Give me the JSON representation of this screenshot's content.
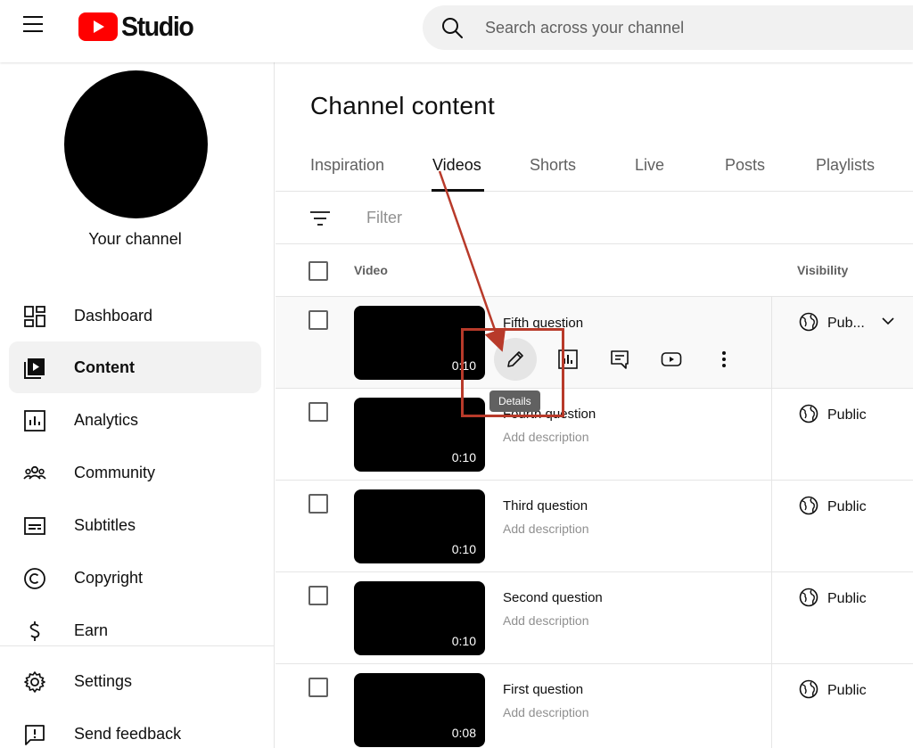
{
  "header": {
    "logo_text": "Studio",
    "search_placeholder": "Search across your channel"
  },
  "sidebar": {
    "channel_label": "Your channel",
    "items": [
      {
        "label": "Dashboard",
        "icon": "dashboard-icon"
      },
      {
        "label": "Content",
        "icon": "content-icon",
        "active": true
      },
      {
        "label": "Analytics",
        "icon": "analytics-icon"
      },
      {
        "label": "Community",
        "icon": "community-icon"
      },
      {
        "label": "Subtitles",
        "icon": "subtitles-icon"
      },
      {
        "label": "Copyright",
        "icon": "copyright-icon"
      },
      {
        "label": "Earn",
        "icon": "earn-icon"
      },
      {
        "label": "Settings",
        "icon": "gear-icon"
      },
      {
        "label": "Send feedback",
        "icon": "feedback-icon"
      }
    ]
  },
  "main": {
    "title": "Channel content",
    "tabs": [
      "Inspiration",
      "Videos",
      "Shorts",
      "Live",
      "Posts",
      "Playlists"
    ],
    "active_tab": "Videos",
    "filter_placeholder": "Filter",
    "columns": {
      "video": "Video",
      "visibility": "Visibility"
    },
    "rows": [
      {
        "title": "Fifth question",
        "description": "",
        "duration": "0:10",
        "visibility": "Pub..."
      },
      {
        "title": "Fourth question",
        "description": "Add description",
        "duration": "0:10",
        "visibility": "Public"
      },
      {
        "title": "Third question",
        "description": "Add description",
        "duration": "0:10",
        "visibility": "Public"
      },
      {
        "title": "Second question",
        "description": "Add description",
        "duration": "0:10",
        "visibility": "Public"
      },
      {
        "title": "First question",
        "description": "Add description",
        "duration": "0:08",
        "visibility": "Public"
      }
    ],
    "tooltip": "Details"
  },
  "colors": {
    "brand_red": "#ff0000",
    "annotation": "#b83a2a",
    "hover_bg": "#f9f9f9"
  }
}
